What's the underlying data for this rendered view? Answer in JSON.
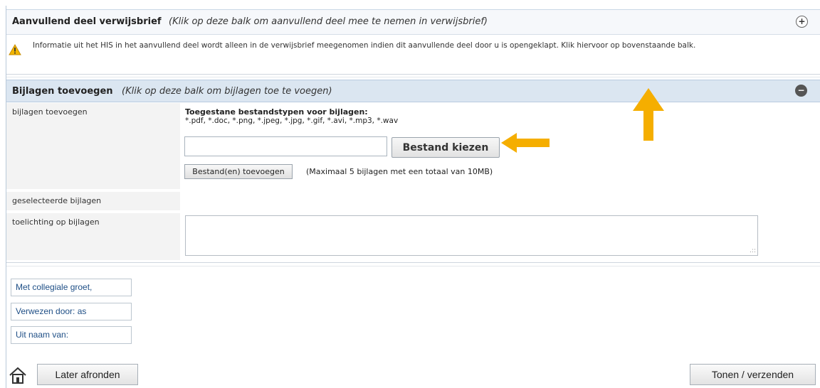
{
  "section_extra": {
    "title": "Aanvullend deel verwijsbrief",
    "hint": "(Klik op deze balk om aanvullend deel mee te nemen in verwijsbrief)",
    "toggle": "+",
    "warning_icon": "warning-triangle-icon",
    "warning_text": "Informatie uit het HIS in het aanvullend deel wordt alleen in de verwijsbrief meegenomen indien dit aanvullende deel door u is opengeklapt. Klik hiervoor op bovenstaande balk."
  },
  "section_attachments": {
    "title": "Bijlagen toevoegen",
    "hint": "(Klik op deze balk om bijlagen toe te voegen)",
    "toggle": "−",
    "label_add": "bijlagen toevoegen",
    "allowed_types_title": "Toegestane bestandstypen voor bijlagen:",
    "allowed_types": "*.pdf, *.doc, *.png, *.jpeg, *.jpg, *.gif, *.avi, *.mp3, *.wav",
    "file_input_value": "",
    "choose_button": "Bestand kiezen",
    "add_button": "Bestand(en) toevoegen",
    "max_note": "(Maximaal 5 bijlagen met een totaal van 10MB)",
    "label_selected": "geselecteerde bijlagen",
    "label_explanation": "toelichting op bijlagen",
    "explanation_value": "",
    "resize_grip": ".::"
  },
  "signature": {
    "greeting": "Met collegiale groet,",
    "referred_by": "Verwezen door: as",
    "on_behalf_of": "Uit naam van:"
  },
  "footer": {
    "home_icon": "home-icon",
    "later_button": "Later afronden",
    "show_send_button": "Tonen / verzenden"
  },
  "colors": {
    "arrow": "#f5ae00",
    "header_blue": "#dbe6f1",
    "signature_text": "#1f4f86"
  }
}
